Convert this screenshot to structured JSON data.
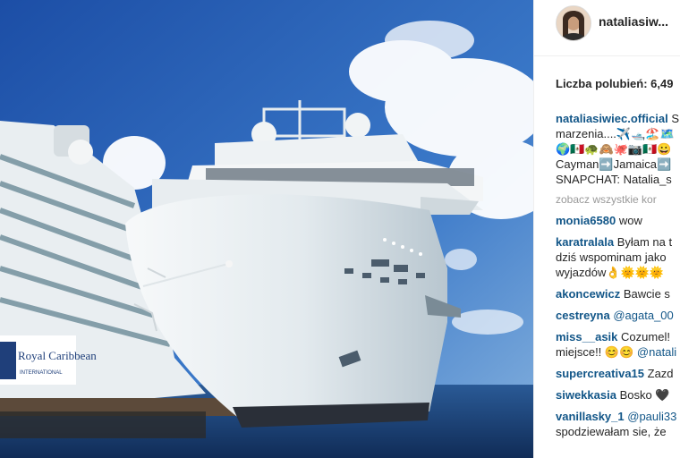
{
  "post": {
    "username": "nataliasiw...",
    "likes_text": "Liczba polubień: 6,49",
    "caption": {
      "user": "nataliasiwiec.official",
      "line1_rest": "S",
      "line2": "marzenia....✈️🛥️🏖️🗺️",
      "line3": "🌍🇲🇽🐢🙈🐙📷🇲🇽😀",
      "line4": "Cayman➡️Jamaica➡️",
      "line5": "SNAPCHAT: Natalia_s"
    },
    "view_all": "zobacz wszystkie kor",
    "comments": [
      {
        "user": "monia6580",
        "lines": [
          "wow"
        ]
      },
      {
        "user": "karatralala",
        "lines": [
          "Byłam na t",
          "dziś wspominam jako",
          "wyjazdów👌🌞🌞🌞"
        ]
      },
      {
        "user": "akoncewicz",
        "lines": [
          "Bawcie s"
        ]
      },
      {
        "user": "cestreyna",
        "mention": "@agata_00",
        "lines": [
          ""
        ]
      },
      {
        "user": "miss__asik",
        "lines": [
          "Cozumel!",
          "miejsce!! 😊😊"
        ],
        "mention2": "@natali"
      },
      {
        "user": "supercreativa15",
        "lines": [
          "Zazd"
        ]
      },
      {
        "user": "siwekkasia",
        "lines": [
          "Bosko 🖤"
        ]
      },
      {
        "user": "vanillasky_1",
        "mention": "@pauli33",
        "lines": [
          "",
          "spodziewałam sie, że"
        ]
      }
    ]
  },
  "photo": {
    "subject": "cruise-ship-photo",
    "sky_color": "#2a5db0",
    "sea_color": "#1c3f7a",
    "ship_hull_color": "#eef2f4",
    "left_ship_logo": "Royal Caribbean",
    "left_ship_logo_sub": "INTERNATIONAL"
  }
}
